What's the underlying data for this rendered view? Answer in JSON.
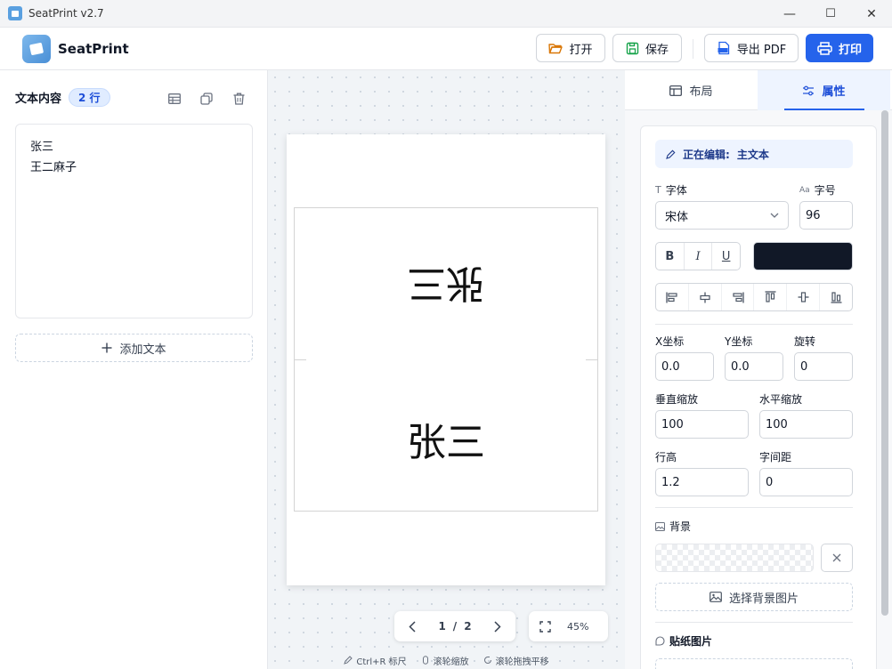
{
  "window": {
    "title": "SeatPrint v2.7",
    "minimize": "—",
    "maximize": "☐",
    "close": "✕"
  },
  "toolbar": {
    "brand": "SeatPrint",
    "open_label": "打开",
    "save_label": "保存",
    "export_label": "导出 PDF",
    "print_label": "打印"
  },
  "left": {
    "heading": "文本内容",
    "line_count": "2 行",
    "text_value": "张三\n王二麻子",
    "add_text_label": "添加文本"
  },
  "canvas": {
    "seat_top": "张三",
    "seat_bottom": "张三",
    "page_current": "1",
    "page_sep": "/",
    "page_total": "2",
    "zoom": "45%"
  },
  "status": {
    "ruler": "Ctrl+R 标尺",
    "wheel_zoom": "滚轮缩放",
    "wheel_pan": "滚轮拖拽平移"
  },
  "tabs": {
    "layout": "布局",
    "properties": "属性"
  },
  "props": {
    "editing_label": "正在编辑:",
    "editing_target": "主文本",
    "font_label": "字体",
    "font_value": "宋体",
    "size_label": "字号",
    "size_value": "96",
    "bold": "B",
    "italic": "I",
    "underline": "U",
    "text_color": "#111827",
    "x_label": "X坐标",
    "x_value": "0.0",
    "y_label": "Y坐标",
    "y_value": "0.0",
    "rotate_label": "旋转",
    "rotate_value": "0",
    "vscale_label": "垂直缩放",
    "vscale_value": "100",
    "hscale_label": "水平缩放",
    "hscale_value": "100",
    "lineheight_label": "行高",
    "lineheight_value": "1.2",
    "spacing_label": "字间距",
    "spacing_value": "0",
    "background_label": "背景",
    "choose_bg_label": "选择背景图片",
    "sticker_label": "贴纸图片"
  },
  "colors": {
    "accent": "#2563eb",
    "accent_soft": "#eef4ff"
  }
}
